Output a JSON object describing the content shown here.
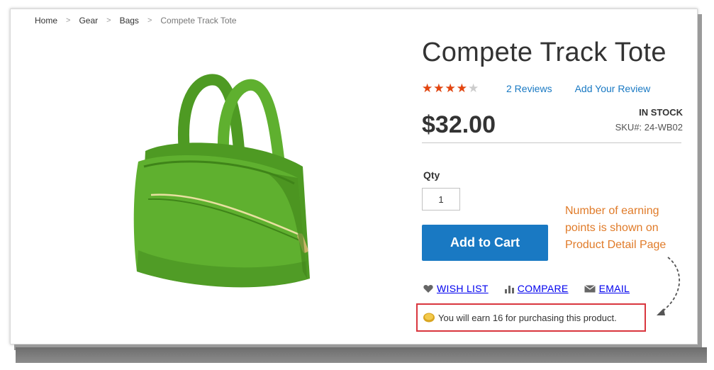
{
  "breadcrumb": {
    "items": [
      "Home",
      "Gear",
      "Bags"
    ],
    "current": "Compete Track Tote"
  },
  "product": {
    "title": "Compete Track Tote",
    "rating": {
      "stars": "★★★★★",
      "value": 3.5,
      "max": 5
    },
    "reviews_link": "2 Reviews",
    "add_review_link": "Add Your Review",
    "price": "$32.00",
    "stock": "IN STOCK",
    "sku_label": "SKU#:",
    "sku": "24-WB02",
    "image_icon": "green-tote-bag",
    "image_color": "#5fb02f"
  },
  "cart": {
    "qty_label": "Qty",
    "qty_value": "1",
    "add_to_cart": "Add to Cart"
  },
  "actions": {
    "wish_list": "WISH LIST",
    "compare": "COMPARE",
    "email": "EMAIL"
  },
  "rewards": {
    "earn_text": "You will earn 16 for purchasing this product.",
    "icon": "coin-icon"
  },
  "callout": {
    "line1": "Number of earning",
    "line2": "points is shown on",
    "line3": "Product Detail Page"
  },
  "colors": {
    "accent": "#1979c3",
    "star": "#e4450f",
    "callout": "#e07b29",
    "highlight_border": "#d9363e"
  }
}
